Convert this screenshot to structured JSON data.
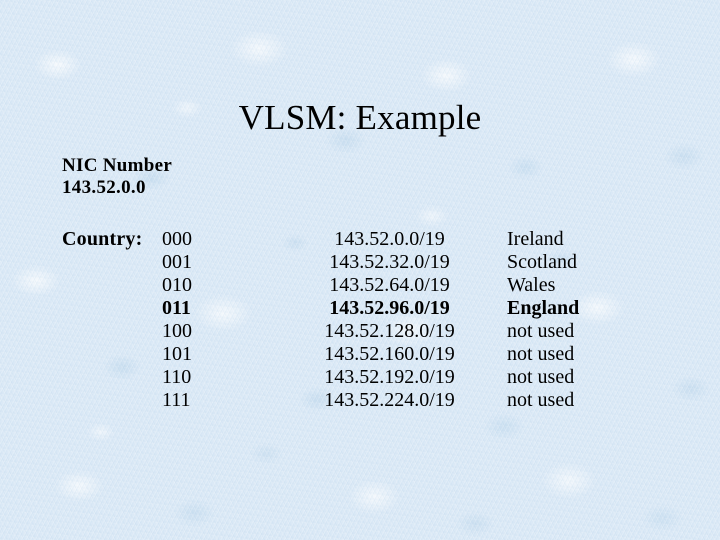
{
  "slide": {
    "title": "VLSM: Example",
    "background_color": "#dceaf7",
    "text_color": "#000000"
  },
  "nic": {
    "heading": "NIC Number",
    "address": "143.52.0.0"
  },
  "table": {
    "row_label": "Country:",
    "rows": [
      {
        "bits": "000",
        "subnet": "143.52.0.0/19",
        "country": "Ireland",
        "bold": false
      },
      {
        "bits": "001",
        "subnet": "143.52.32.0/19",
        "country": "Scotland",
        "bold": false
      },
      {
        "bits": "010",
        "subnet": "143.52.64.0/19",
        "country": "Wales",
        "bold": false
      },
      {
        "bits": "011",
        "subnet": "143.52.96.0/19",
        "country": "England",
        "bold": true
      },
      {
        "bits": "100",
        "subnet": "143.52.128.0/19",
        "country": "not used",
        "bold": false
      },
      {
        "bits": "101",
        "subnet": "143.52.160.0/19",
        "country": "not used",
        "bold": false
      },
      {
        "bits": "110",
        "subnet": "143.52.192.0/19",
        "country": "not used",
        "bold": false
      },
      {
        "bits": "111",
        "subnet": "143.52.224.0/19",
        "country": "not used",
        "bold": false
      }
    ]
  }
}
